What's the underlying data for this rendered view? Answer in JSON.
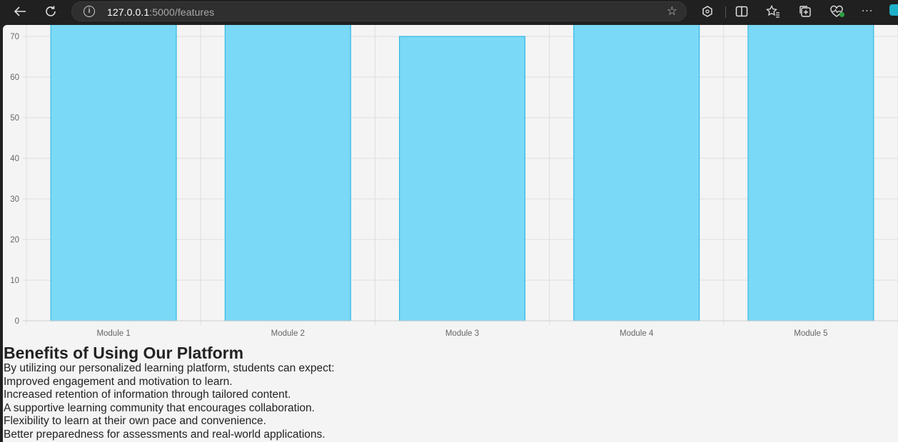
{
  "browser": {
    "url_host": "127.0.0.1",
    "url_rest": ":5000/features",
    "icons": [
      "back-arrow-icon",
      "refresh-icon",
      "site-info-icon",
      "favorite-star-icon",
      "extensions-icon",
      "split-screen-icon",
      "favorites-icon",
      "collections-icon",
      "browser-essentials-icon",
      "more-icon"
    ]
  },
  "chart_data": {
    "type": "bar",
    "categories": [
      "Module 1",
      "Module 2",
      "Module 3",
      "Module 4",
      "Module 5"
    ],
    "values": [
      75,
      75,
      70,
      75,
      75
    ],
    "ylim": [
      0,
      73
    ],
    "yticks": [
      0,
      10,
      20,
      30,
      40,
      50,
      60,
      70
    ],
    "grid": true,
    "colors": {
      "fill": "#7ad9f6",
      "stroke": "#36b9e4",
      "grid": "#dedede"
    }
  },
  "benefits": {
    "title": "Benefits of Using Our Platform",
    "intro": "By utilizing our personalized learning platform, students can expect:",
    "items": [
      "Improved engagement and motivation to learn.",
      "Increased retention of information through tailored content.",
      "A supportive learning community that encourages collaboration.",
      "Flexibility to learn at their own pace and convenience.",
      "Better preparedness for assessments and real-world applications."
    ]
  }
}
